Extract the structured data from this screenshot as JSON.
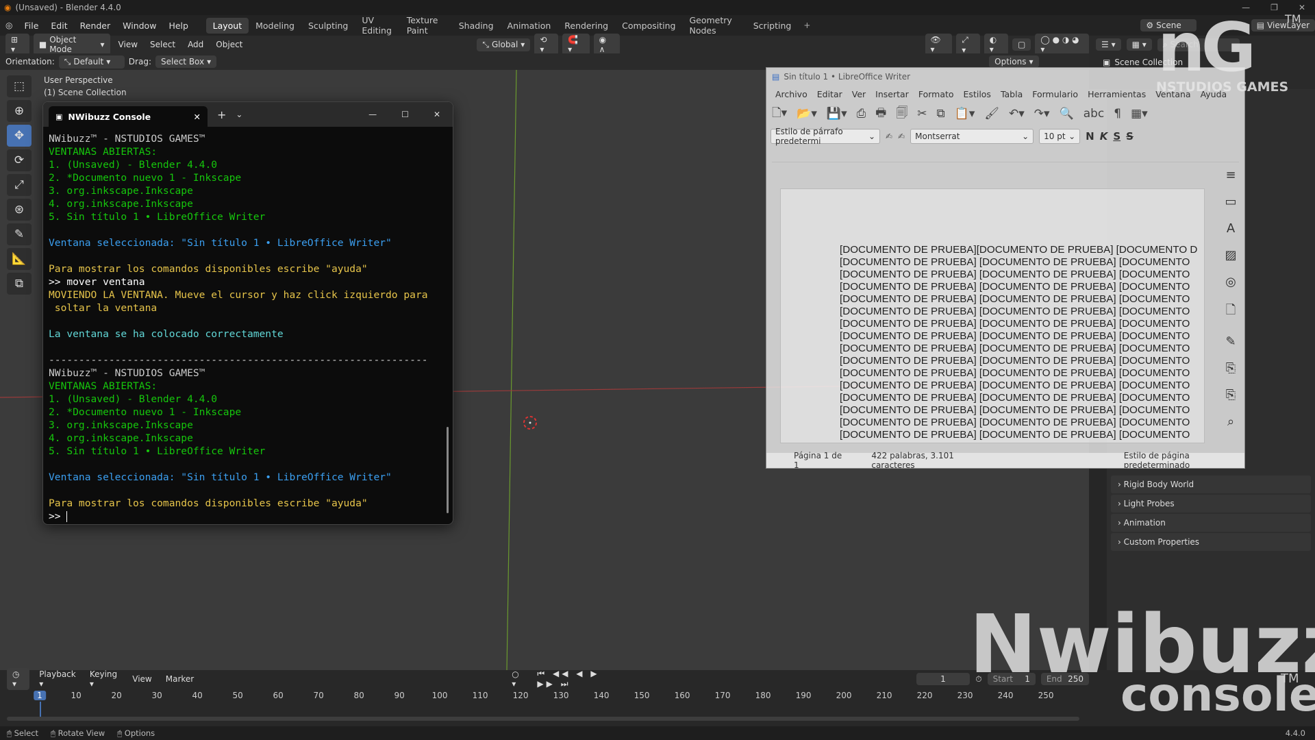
{
  "blender": {
    "title": "(Unsaved) - Blender 4.4.0",
    "menu": [
      "File",
      "Edit",
      "Render",
      "Window",
      "Help"
    ],
    "workspaces": [
      "Layout",
      "Modeling",
      "Sculpting",
      "UV Editing",
      "Texture Paint",
      "Shading",
      "Animation",
      "Rendering",
      "Compositing",
      "Geometry Nodes",
      "Scripting"
    ],
    "active_workspace": "Layout",
    "scene": "Scene",
    "view_layer": "ViewLayer",
    "mode": "Object Mode",
    "header_menus": [
      "View",
      "Select",
      "Add",
      "Object"
    ],
    "transform": "Global",
    "orientation_label": "Orientation:",
    "orientation_value": "Default",
    "drag_label": "Drag:",
    "drag_value": "Select Box",
    "options": "Options",
    "viewport_label": "User Perspective",
    "viewport_collection": "(1) Scene Collection",
    "outliner_root": "Scene Collection",
    "search_placeholder": "Search",
    "properties": [
      "Rigid Body World",
      "Light Probes",
      "Animation",
      "Custom Properties"
    ],
    "timeline": {
      "menus": [
        "Playback",
        "Keying",
        "View",
        "Marker"
      ],
      "current_frame": "1",
      "start_label": "Start",
      "start": "1",
      "end_label": "End",
      "end": "250",
      "ticks": [
        "1",
        "10",
        "20",
        "30",
        "40",
        "50",
        "60",
        "70",
        "80",
        "90",
        "100",
        "110",
        "120",
        "130",
        "140",
        "150",
        "160",
        "170",
        "180",
        "190",
        "200",
        "210",
        "220",
        "230",
        "240",
        "250"
      ]
    },
    "status": [
      "Select",
      "Rotate View",
      "Options"
    ],
    "version": "4.4.0"
  },
  "console": {
    "tab_title": "NWibuzz Console",
    "lines": [
      {
        "text": "NWibuzz™ - NSTUDIOS GAMES™",
        "color": "white"
      },
      {
        "text": "VENTANAS ABIERTAS:",
        "color": "green"
      },
      {
        "text": "1. (Unsaved) - Blender 4.4.0",
        "color": "green"
      },
      {
        "text": "2. *Documento nuevo 1 - Inkscape",
        "color": "green"
      },
      {
        "text": "3. org.inkscape.Inkscape",
        "color": "green"
      },
      {
        "text": "4. org.inkscape.Inkscape",
        "color": "green"
      },
      {
        "text": "5. Sin título 1 • LibreOffice Writer",
        "color": "green"
      },
      {
        "text": "",
        "color": "white"
      },
      {
        "text": "Ventana seleccionada: \"Sin título 1 • LibreOffice Writer\"",
        "color": "blue"
      },
      {
        "text": "",
        "color": "white"
      },
      {
        "text": "Para mostrar los comandos disponibles escribe \"ayuda\"",
        "color": "yellow"
      },
      {
        "text": ">> mover ventana",
        "color": "fg"
      },
      {
        "text": "MOVIENDO LA VENTANA. Mueve el cursor y haz click izquierdo para",
        "color": "yellow"
      },
      {
        "text": " soltar la ventana",
        "color": "yellow"
      },
      {
        "text": "",
        "color": "white"
      },
      {
        "text": "La ventana se ha colocado correctamente",
        "color": "cyan"
      },
      {
        "text": "",
        "color": "white"
      },
      {
        "text": "---------------------------------------------------------------",
        "color": "white"
      },
      {
        "text": "NWibuzz™ - NSTUDIOS GAMES™",
        "color": "white"
      },
      {
        "text": "VENTANAS ABIERTAS:",
        "color": "green"
      },
      {
        "text": "1. (Unsaved) - Blender 4.4.0",
        "color": "green"
      },
      {
        "text": "2. *Documento nuevo 1 - Inkscape",
        "color": "green"
      },
      {
        "text": "3. org.inkscape.Inkscape",
        "color": "green"
      },
      {
        "text": "4. org.inkscape.Inkscape",
        "color": "green"
      },
      {
        "text": "5. Sin título 1 • LibreOffice Writer",
        "color": "green"
      },
      {
        "text": "",
        "color": "white"
      },
      {
        "text": "Ventana seleccionada: \"Sin título 1 • LibreOffice Writer\"",
        "color": "blue"
      },
      {
        "text": "",
        "color": "white"
      },
      {
        "text": "Para mostrar los comandos disponibles escribe \"ayuda\"",
        "color": "yellow"
      },
      {
        "text": ">> ",
        "color": "fg"
      }
    ]
  },
  "writer": {
    "title": "Sin título 1 • LibreOffice Writer",
    "menu": [
      "Archivo",
      "Editar",
      "Ver",
      "Insertar",
      "Formato",
      "Estilos",
      "Tabla",
      "Formulario",
      "Herramientas",
      "Ventana",
      "Ayuda"
    ],
    "para_style": "Estilo de párrafo predetermi",
    "font": "Montserrat",
    "font_size": "10 pt",
    "doc_first_line": "[DOCUMENTO DE PRUEBA][DOCUMENTO DE PRUEBA] [DOCUMENTO D",
    "doc_line": "[DOCUMENTO DE PRUEBA] [DOCUMENTO DE PRUEBA] [DOCUMENTO",
    "doc_line_count": 16,
    "status_page": "Página 1 de 1",
    "status_words": "422 palabras, 3.101 caracteres",
    "status_style": "Estilo de página predeterminado"
  },
  "watermark": {
    "logo": "nG",
    "tm": "TM",
    "studio": "NSTUDIOS GAMES",
    "brand": "Nwibuzz",
    "product": "console"
  }
}
